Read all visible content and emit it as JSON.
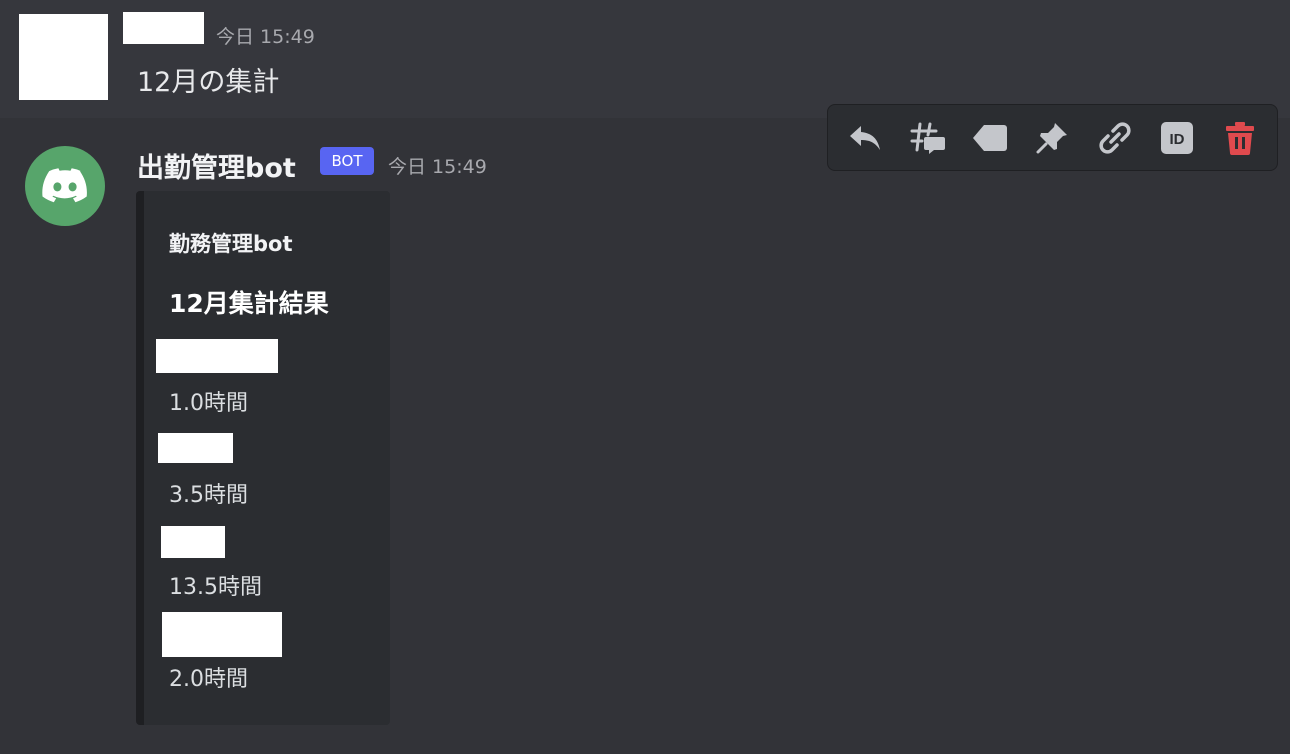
{
  "messages": [
    {
      "timestamp": "今日 15:49",
      "content": "12月の集計"
    },
    {
      "author": "出勤管理bot",
      "bot_tag": "BOT",
      "timestamp": "今日 15:49",
      "embed": {
        "author": "勤務管理bot",
        "title": "12月集計結果",
        "fields": [
          {
            "value": "1.0時間"
          },
          {
            "value": "3.5時間"
          },
          {
            "value": "13.5時間"
          },
          {
            "value": "2.0時間"
          }
        ]
      }
    }
  ],
  "toolbar": {
    "icons": [
      "reply-icon",
      "thread-icon",
      "tag-icon",
      "pin-icon",
      "link-icon",
      "id-icon",
      "trash-icon"
    ]
  },
  "colors": {
    "background": "#36373d",
    "hover_background": "#323338",
    "embed_background": "#2b2d31",
    "bot_tag": "#5865f2",
    "bot_avatar": "#57a56b",
    "delete": "#e04a4e",
    "icon": "#c4c6cb"
  }
}
